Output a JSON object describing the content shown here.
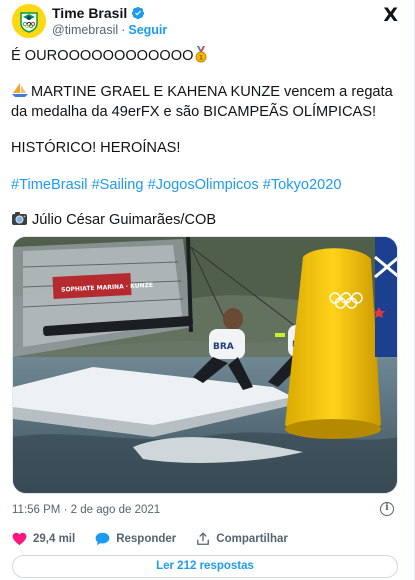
{
  "header": {
    "name": "Time Brasil",
    "handle": "@timebrasil",
    "separator": "·",
    "follow_label": "Seguir",
    "logo": "X"
  },
  "tweet": {
    "line1": "É OUROOOOOOOOOOOO",
    "line2": "MARTINE GRAEL E KAHENA KUNZE vencem a regata da medalha da 49erFX e são BICAMPEÃS OLÍMPICAS!",
    "line3": "HISTÓRICO! HEROÍNAS!",
    "hashtags": [
      "#TimeBrasil",
      "#Sailing",
      "#JogosOlimpicos",
      "#Tokyo2020"
    ],
    "credit": "Júlio César Guimarães/COB",
    "icons": [
      "gold-medal-icon",
      "sailboat-icon",
      "camera-icon"
    ]
  },
  "photo": {
    "boat_label": "BRA",
    "sail_text": "SOPHIATE MARINA · KUNZE"
  },
  "meta": {
    "time": "11:56 PM",
    "separator": "·",
    "date": "2 de ago de 2021"
  },
  "actions": {
    "likes": "29,4 mil",
    "reply_label": "Responder",
    "share_label": "Compartilhar"
  },
  "replies_button": "Ler 212 respostas",
  "colors": {
    "accent": "#1d9bf0",
    "like": "#f91880",
    "text": "#0f1419",
    "muted": "#536471"
  }
}
